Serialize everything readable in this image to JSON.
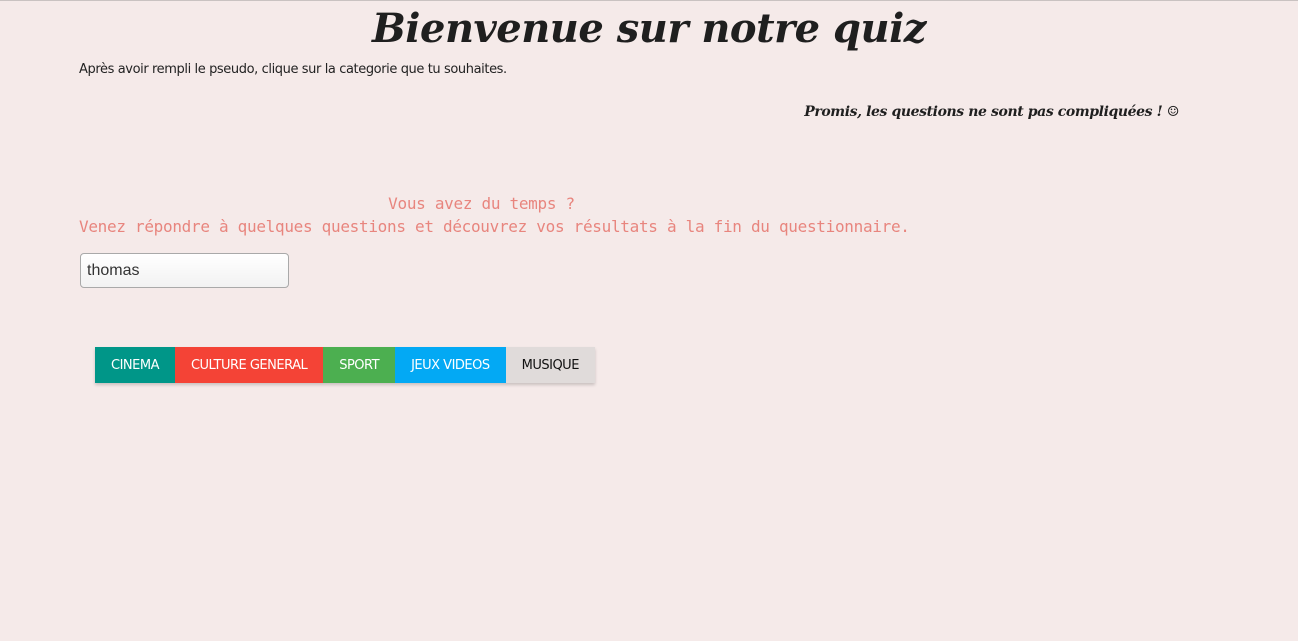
{
  "header": {
    "title": "Bienvenue sur notre quiz",
    "instructions": "Après avoir rempli le pseudo, clique sur la categorie que tu souhaites.",
    "promise": "Promis, les questions ne sont pas compliquées ! ☺"
  },
  "intro": {
    "line1": "Vous avez du temps ?",
    "line2": "Venez répondre à quelques questions et découvrez vos résultats à la fin du questionnaire."
  },
  "pseudo": {
    "value": "thomas"
  },
  "categories": [
    {
      "label": "CINEMA",
      "color": "#009688"
    },
    {
      "label": "CULTURE GENERAL",
      "color": "#f44336"
    },
    {
      "label": "SPORT",
      "color": "#4caf50"
    },
    {
      "label": "JEUX VIDEOS",
      "color": "#03a9f4"
    },
    {
      "label": "MUSIQUE",
      "color": "#e0dbda"
    }
  ],
  "colors": {
    "background": "#f5eae9",
    "intro_text": "#e8857e"
  }
}
